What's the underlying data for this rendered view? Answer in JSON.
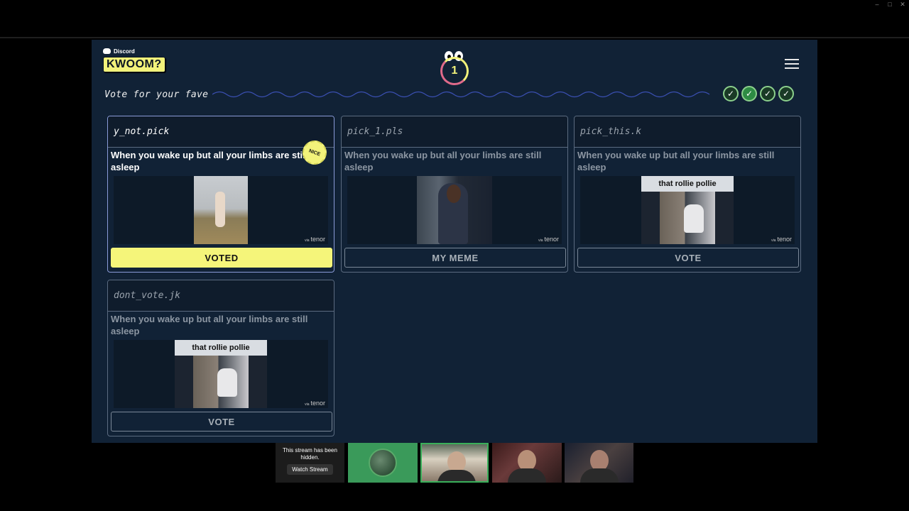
{
  "window_controls": [
    "–",
    "□",
    "✕"
  ],
  "brand": {
    "platform": "Discord",
    "logo": "KWOOM?"
  },
  "round": {
    "number": "1"
  },
  "prompt": "Vote for your fave",
  "players_checked": 4,
  "cards": [
    {
      "author": "y_not.pick",
      "caption": "When you wake up but all your limbs are still asleep",
      "gif_text": "",
      "button": "VOTED",
      "state": "voted",
      "badge": "NICE"
    },
    {
      "author": "pick_1.pls",
      "caption": "When you wake up but all your limbs are still asleep",
      "gif_text": "",
      "button": "MY MEME",
      "state": "mine"
    },
    {
      "author": "pick_this.k",
      "caption": "When you wake up but all your limbs are still asleep",
      "gif_text": "that rollie pollie",
      "button": "VOTE",
      "state": "open"
    },
    {
      "author": "dont_vote.jk",
      "caption": "When you wake up but all your limbs are still asleep",
      "gif_text": "that rollie pollie",
      "button": "VOTE",
      "state": "open"
    }
  ],
  "gif_source": {
    "via": "via",
    "name": "tenor"
  },
  "stream": {
    "hidden_msg": "This stream has been hidden.",
    "watch_label": "Watch Stream"
  },
  "colors": {
    "background": "#112236",
    "accent": "#f5f57a",
    "check": "#2e8b44"
  }
}
